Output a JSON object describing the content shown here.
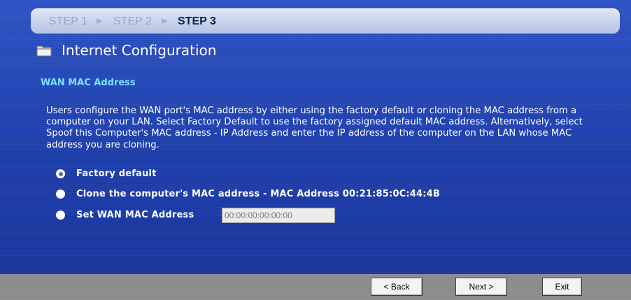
{
  "steps": [
    {
      "label": "STEP 1",
      "state": "inactive"
    },
    {
      "label": "STEP 2",
      "state": "inactive"
    },
    {
      "label": "STEP 3",
      "state": "active"
    }
  ],
  "page": {
    "title": "Internet Configuration",
    "title_icon": "folder-icon"
  },
  "section": {
    "title": "WAN MAC Address",
    "description": "Users configure the WAN port's MAC address by either using the factory default or cloning the MAC address from a computer on your LAN. Select Factory Default to use the factory assigned default MAC address. Alternatively, select Spoof this Computer's MAC address - IP Address and enter the IP address of the computer on the LAN whose MAC address you are cloning."
  },
  "options": [
    {
      "label": "Factory default",
      "selected": true
    },
    {
      "label": "Clone the computer's MAC address - MAC Address 00:21:85:0C:44:4B",
      "selected": false
    },
    {
      "label": "Set WAN MAC Address",
      "selected": false
    }
  ],
  "mac_input": {
    "value": "00:00:00:00:00:00"
  },
  "buttons": {
    "back": "< Back",
    "next": "Next >",
    "exit": "Exit"
  },
  "colors": {
    "background": "#1d3fa7",
    "section_title": "#7fe0ff",
    "footer": "#8b8b8b"
  }
}
